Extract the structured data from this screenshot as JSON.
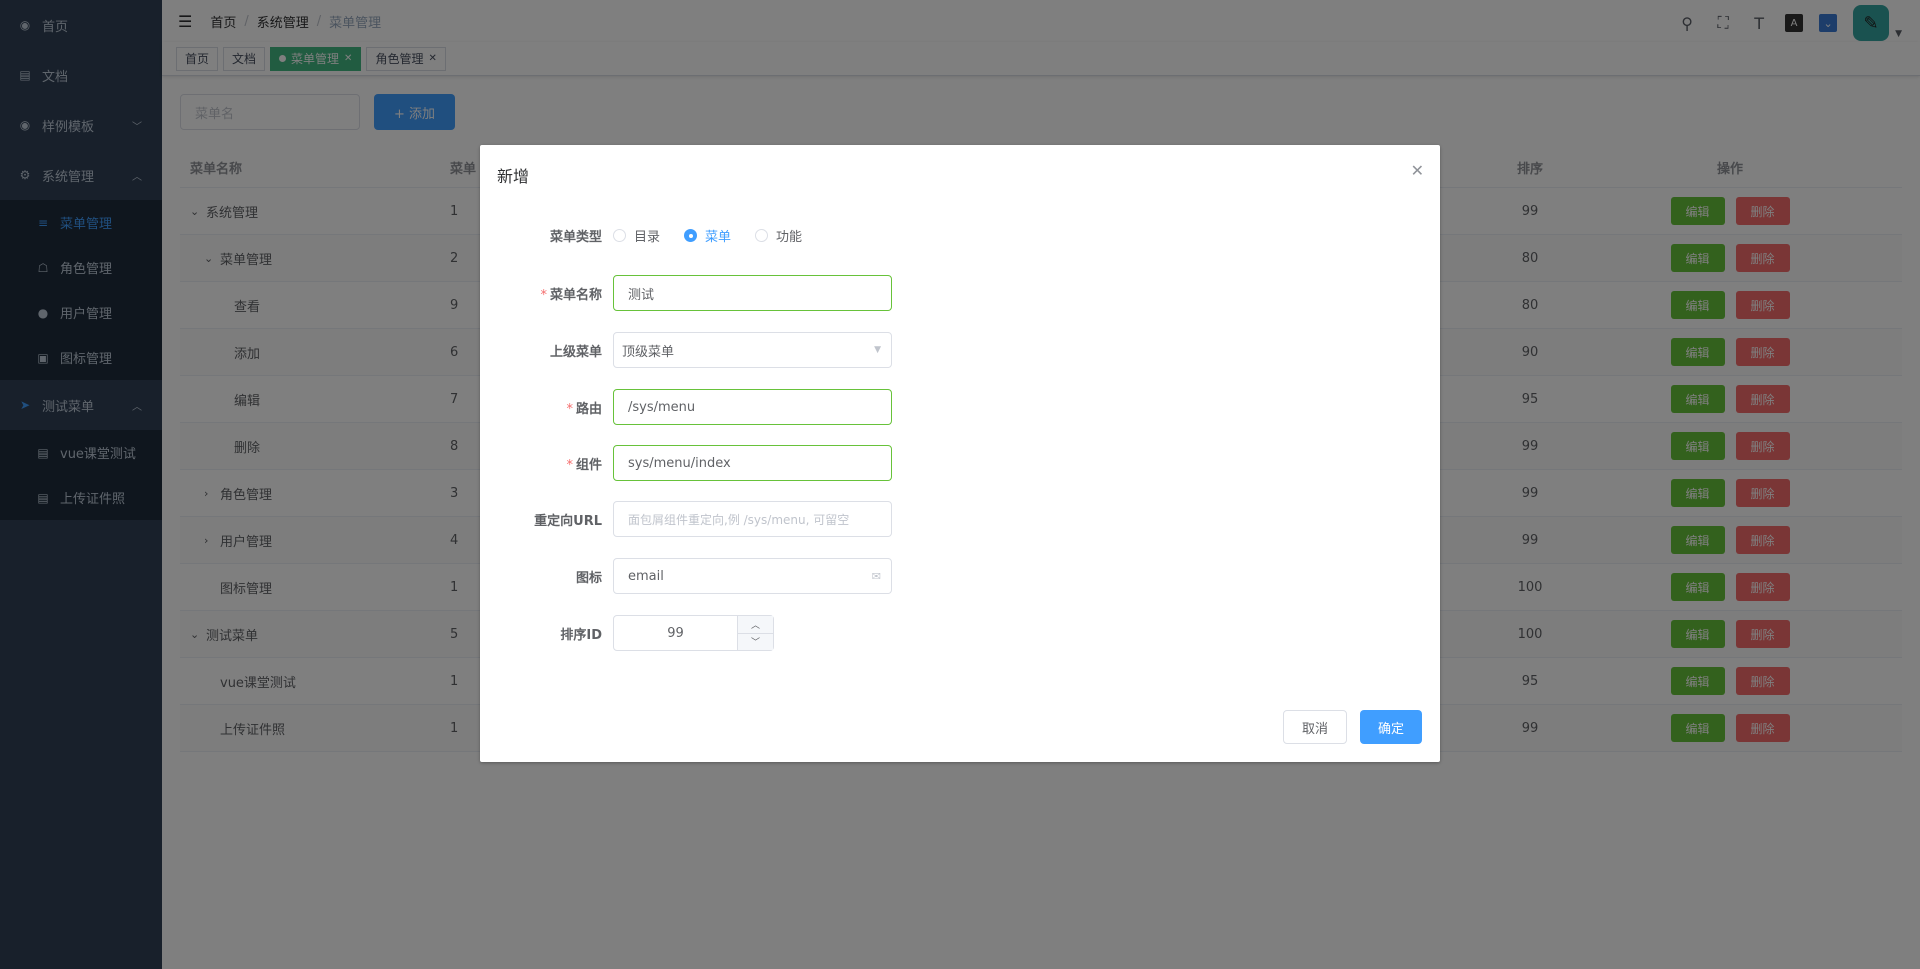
{
  "sidebar": {
    "items": [
      {
        "icon": "dashboard-icon",
        "glyph": "◉",
        "label": "首页"
      },
      {
        "icon": "document-icon",
        "glyph": "▤",
        "label": "文档"
      },
      {
        "icon": "template-icon",
        "glyph": "◉",
        "label": "样例模板"
      },
      {
        "icon": "settings-icon",
        "glyph": "⚙",
        "label": "系统管理"
      }
    ],
    "system_children": [
      {
        "icon": "list-icon",
        "glyph": "≡",
        "label": "菜单管理"
      },
      {
        "icon": "role-icon",
        "glyph": "☖",
        "label": "角色管理"
      },
      {
        "icon": "user-icon",
        "glyph": "●",
        "label": "用户管理"
      },
      {
        "icon": "icon-manage-icon",
        "glyph": "▣",
        "label": "图标管理"
      }
    ],
    "test_menu": {
      "icon": "send-icon",
      "glyph": "➤",
      "label": "测试菜单"
    },
    "test_children": [
      {
        "icon": "doc-icon",
        "glyph": "▤",
        "label": "vue课堂测试"
      },
      {
        "icon": "doc-icon",
        "glyph": "▤",
        "label": "上传证件照"
      }
    ]
  },
  "breadcrumb": [
    "首页",
    "系统管理",
    "菜单管理"
  ],
  "tags": [
    {
      "label": "首页",
      "active": false
    },
    {
      "label": "文档",
      "active": false
    },
    {
      "label": "菜单管理",
      "active": true
    },
    {
      "label": "角色管理",
      "active": false
    }
  ],
  "toolbar": {
    "search_placeholder": "菜单名",
    "add_label": "+ 添加"
  },
  "table": {
    "headers": {
      "name": "菜单名称",
      "code": "菜单",
      "sort": "排序",
      "ops": "操作"
    },
    "edit_label": "编辑",
    "delete_label": "删除",
    "rows": [
      {
        "name": "系统管理",
        "indent": 0,
        "expander": "⌄",
        "code": "1",
        "sort": "99"
      },
      {
        "name": "菜单管理",
        "indent": 1,
        "expander": "⌄",
        "code": "2",
        "sort": "80"
      },
      {
        "name": "查看",
        "indent": 2,
        "expander": "",
        "code": "9",
        "sort": "80"
      },
      {
        "name": "添加",
        "indent": 2,
        "expander": "",
        "code": "6",
        "sort": "90"
      },
      {
        "name": "编辑",
        "indent": 2,
        "expander": "",
        "code": "7",
        "sort": "95"
      },
      {
        "name": "删除",
        "indent": 2,
        "expander": "",
        "code": "8",
        "sort": "99"
      },
      {
        "name": "角色管理",
        "indent": 1,
        "expander": "›",
        "code": "3",
        "sort": "99"
      },
      {
        "name": "用户管理",
        "indent": 1,
        "expander": "›",
        "code": "4",
        "sort": "99"
      },
      {
        "name": "图标管理",
        "indent": 1,
        "expander": "",
        "code": "1",
        "sort": "100"
      },
      {
        "name": "测试菜单",
        "indent": 0,
        "expander": "⌄",
        "code": "5",
        "sort": "100"
      },
      {
        "name": "vue课堂测试",
        "indent": 1,
        "expander": "",
        "code": "1",
        "sort": "95"
      },
      {
        "name": "上传证件照",
        "indent": 1,
        "expander": "",
        "code": "1",
        "sort": "99"
      }
    ]
  },
  "dialog": {
    "title": "新增",
    "type_label": "菜单类型",
    "type_options": [
      {
        "label": "目录",
        "checked": false
      },
      {
        "label": "菜单",
        "checked": true
      },
      {
        "label": "功能",
        "checked": false
      }
    ],
    "name_label": "菜单名称",
    "name_value": "测试",
    "parent_label": "上级菜单",
    "parent_value": "顶级菜单",
    "path_label": "路由",
    "path_value": "/sys/menu",
    "component_label": "组件",
    "component_value": "sys/menu/index",
    "redirect_label": "重定向URL",
    "redirect_placeholder": "面包屑组件重定向,例 /sys/menu, 可留空",
    "icon_label": "图标",
    "icon_value": "email",
    "sort_label": "排序ID",
    "sort_value": "99",
    "cancel_label": "取消",
    "confirm_label": "确定"
  },
  "colors": {
    "primary": "#409eff",
    "success": "#67c23a",
    "danger": "#f56c6c",
    "sidebar": "#304156",
    "tag_active": "#42b983"
  }
}
